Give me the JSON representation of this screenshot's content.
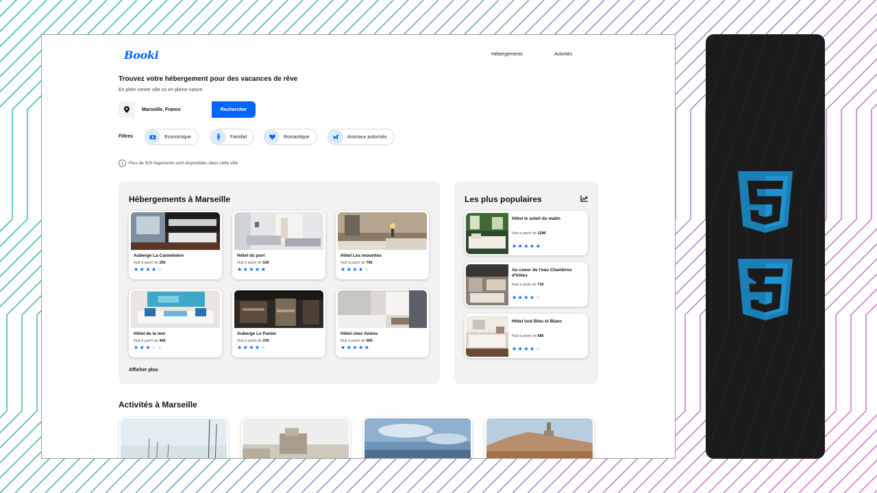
{
  "app": {
    "logo": "Booki",
    "nav": [
      "Hébergements",
      "Activités"
    ]
  },
  "hero": {
    "title": "Trouvez votre hébergement pour des vacances de rêve",
    "subtitle": "En plein centre ville ou en pleine nature"
  },
  "search": {
    "value": "Marseille, France",
    "button": "Rechercher",
    "icon": "map-pin-icon"
  },
  "filters": {
    "label": "Filtres",
    "items": [
      {
        "label": "Economique",
        "icon": "money-icon"
      },
      {
        "label": "Familial",
        "icon": "child-icon"
      },
      {
        "label": "Romantique",
        "icon": "heart-icon"
      },
      {
        "label": "Animaux autorisés",
        "icon": "dog-icon"
      }
    ]
  },
  "info": {
    "text": "Plus de 500 logements sont disponibles dans cette ville",
    "icon": "info-icon"
  },
  "accommodations": {
    "title": "Hébergements à Marseille",
    "price_prefix": "Nuit à partir de",
    "items": [
      {
        "name": "Auberge La Cannebière",
        "price": "25€",
        "rating": 4
      },
      {
        "name": "Hôtel du port",
        "price": "52€",
        "rating": 5
      },
      {
        "name": "Hôtel Les mouettes",
        "price": "76€",
        "rating": 4
      },
      {
        "name": "Hôtel de la mer",
        "price": "46€",
        "rating": 3
      },
      {
        "name": "Auberge Le Panier",
        "price": "23€",
        "rating": 4
      },
      {
        "name": "Hôtel chez Amina",
        "price": "96€",
        "rating": 5
      }
    ],
    "more": "Afficher plus"
  },
  "popular": {
    "title": "Les plus populaires",
    "icon": "trending-up-icon",
    "price_prefix": "Nuit à partir de",
    "items": [
      {
        "name": "Hôtel le soleil du matin",
        "price": "128€",
        "rating": 5
      },
      {
        "name": "Au coeur de l'eau Chambres d'hôtes",
        "price": "71€",
        "rating": 4
      },
      {
        "name": "Hôtel tout Bleu et Blanc",
        "price": "68€",
        "rating": 4
      }
    ]
  },
  "activities": {
    "title": "Activités à Marseille",
    "count": 4
  },
  "colors": {
    "accent": "#0065fc",
    "chip_bg": "#deebff",
    "panel_bg": "#f2f2f2",
    "star_off": "#d9d9d9",
    "side_panel": "#1b1b1b",
    "tech_logo": "#1a7fb6"
  },
  "side_logos": [
    "html5-logo",
    "css3-logo"
  ]
}
